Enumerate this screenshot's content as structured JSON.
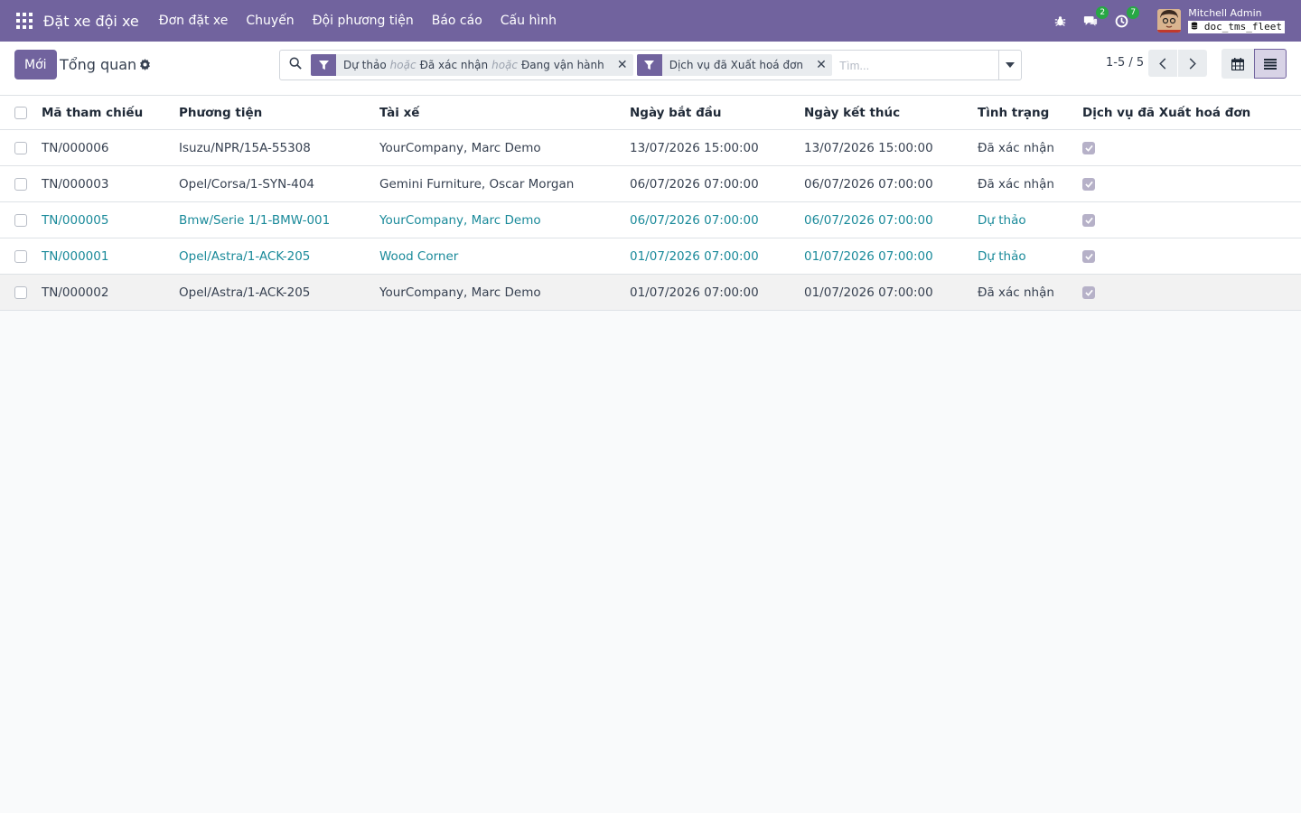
{
  "navbar": {
    "brand": "Đặt xe đội xe",
    "menu": [
      "Đơn đặt xe",
      "Chuyến",
      "Đội phương tiện",
      "Báo cáo",
      "Cấu hình"
    ],
    "messages_count": "2",
    "activities_count": "7",
    "user_name": "Mitchell Admin",
    "db_name": "doc_tms_fleet"
  },
  "control": {
    "new_label": "Mới",
    "breadcrumb": "Tổng quan",
    "facet1": {
      "a": "Dự thảo",
      "or1": "hoặc",
      "b": "Đã xác nhận",
      "or2": "hoặc",
      "c": "Đang vận hành"
    },
    "facet2": "Dịch vụ đã Xuất hoá đơn",
    "search_placeholder": "Tìm...",
    "pager": "1-5 / 5"
  },
  "table": {
    "headers": [
      "Mã tham chiếu",
      "Phương tiện",
      "Tài xế",
      "Ngày bắt đầu",
      "Ngày kết thúc",
      "Tình trạng",
      "Dịch vụ đã Xuất hoá đơn"
    ],
    "rows": [
      {
        "ref": "TN/000006",
        "vehicle": "Isuzu/NPR/15A-55308",
        "driver": "YourCompany, Marc Demo",
        "start": "13/07/2026 15:00:00",
        "end": "13/07/2026 15:00:00",
        "state": "Đã xác nhận"
      },
      {
        "ref": "TN/000003",
        "vehicle": "Opel/Corsa/1-SYN-404",
        "driver": "Gemini Furniture, Oscar Morgan",
        "start": "06/07/2026 07:00:00",
        "end": "06/07/2026 07:00:00",
        "state": "Đã xác nhận"
      },
      {
        "ref": "TN/000005",
        "vehicle": "Bmw/Serie 1/1-BMW-001",
        "driver": "YourCompany, Marc Demo",
        "start": "06/07/2026 07:00:00",
        "end": "06/07/2026 07:00:00",
        "state": "Dự thảo"
      },
      {
        "ref": "TN/000001",
        "vehicle": "Opel/Astra/1-ACK-205",
        "driver": "Wood Corner",
        "start": "01/07/2026 07:00:00",
        "end": "01/07/2026 07:00:00",
        "state": "Dự thảo"
      },
      {
        "ref": "TN/000002",
        "vehicle": "Opel/Astra/1-ACK-205",
        "driver": "YourCompany, Marc Demo",
        "start": "01/07/2026 07:00:00",
        "end": "01/07/2026 07:00:00",
        "state": "Đã xác nhận"
      }
    ]
  },
  "colors": {
    "brand": "#71639e",
    "draft_text": "#1a8a9a"
  }
}
